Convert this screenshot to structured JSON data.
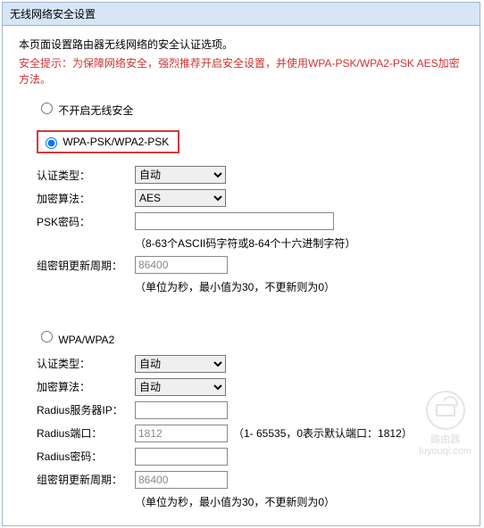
{
  "header": {
    "title": "无线网络安全设置"
  },
  "intro": "本页面设置路由器无线网络的安全认证选项。",
  "warning": "安全提示：为保障网络安全，强烈推荐开启安全设置，并使用WPA-PSK/WPA2-PSK AES加密方法。",
  "options": {
    "no_security_label": "不开启无线安全",
    "wpa_psk_label": "WPA-PSK/WPA2-PSK",
    "wpa_label": "WPA/WPA2"
  },
  "wpa_psk": {
    "auth_label": "认证类型：",
    "auth_value": "自动",
    "encrypt_label": "加密算法：",
    "encrypt_value": "AES",
    "psk_label": "PSK密码：",
    "psk_value": "",
    "psk_hint": "（8-63个ASCII码字符或8-64个十六进制字符）",
    "interval_label": "组密钥更新周期：",
    "interval_value": "86400",
    "interval_hint": "（单位为秒，最小值为30，不更新则为0）"
  },
  "wpa": {
    "auth_label": "认证类型：",
    "auth_value": "自动",
    "encrypt_label": "加密算法：",
    "encrypt_value": "自动",
    "radius_ip_label": "Radius服务器IP：",
    "radius_ip_value": "",
    "radius_port_label": "Radius端口：",
    "radius_port_value": "1812",
    "radius_port_hint": "（1- 65535，0表示默认端口：1812）",
    "radius_pw_label": "Radius密码：",
    "radius_pw_value": "",
    "interval_label": "组密钥更新周期：",
    "interval_value": "86400",
    "interval_hint": "（单位为秒，最小值为30，不更新则为0）"
  },
  "watermark": {
    "text": "路由器",
    "sub": "luyouqi.com"
  }
}
